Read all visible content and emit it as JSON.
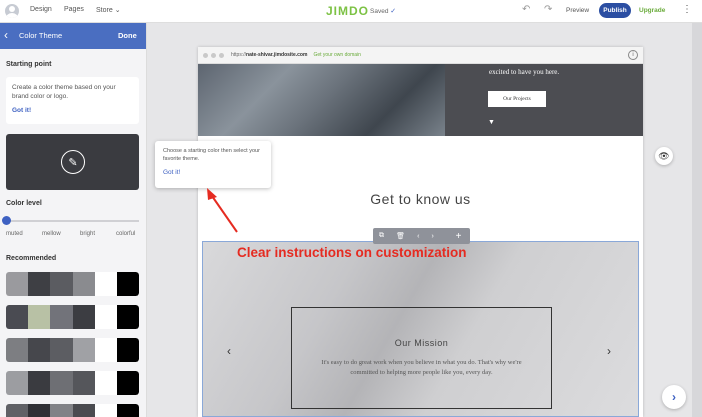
{
  "topbar": {
    "nav": [
      "Design",
      "Pages",
      "Store"
    ],
    "store_chevron": "⌄",
    "logo": "JIMDO",
    "saved": "Saved",
    "check_icon": "✓",
    "undo_icon": "↶",
    "redo_icon": "↷",
    "preview": "Preview",
    "publish": "Publish",
    "upgrade": "Upgrade",
    "more_icon": "⋮"
  },
  "panel": {
    "back_icon": "‹",
    "title": "Color Theme",
    "done": "Done",
    "starting_point_label": "Starting point",
    "info_text": "Create a color theme based on your brand color or logo.",
    "info_link": "Got it!",
    "pencil_icon": "✎",
    "color_level_label": "Color level",
    "levels": [
      "muted",
      "mellow",
      "bright",
      "colorful"
    ],
    "color_level_value": 0,
    "recommended_label": "Recommended",
    "swatches": [
      [
        "#9a9a9e",
        "#3e3f44",
        "#5b5c61",
        "#8a8b8f",
        "#ffffff",
        "#000000"
      ],
      [
        "#4a4b52",
        "#b8c1a5",
        "#72737a",
        "#3c3d42",
        "#ffffff",
        "#000000"
      ],
      [
        "#7d7e82",
        "#46474c",
        "#5c5d62",
        "#a0a1a5",
        "#ffffff",
        "#000000"
      ],
      [
        "#9c9da1",
        "#3a3b40",
        "#6e6f74",
        "#55565b",
        "#ffffff",
        "#000000"
      ],
      [
        "#606166",
        "#2f3035",
        "#818287",
        "#4a4b50",
        "#ffffff",
        "#000000"
      ]
    ]
  },
  "browser": {
    "url_prefix": "https://",
    "url_site": "nate-shivar.jimdosite.com",
    "url_domain": "Get your own domain",
    "info_icon": "i"
  },
  "site": {
    "hero_text": "excited to have you here.",
    "hero_button": "Our Projects",
    "hero_arrow": "▼",
    "section_title": "Get to know us",
    "mission_title": "Our Mission",
    "mission_text": "It's easy to do great work when you believe in what you do. That's why we're committed to helping more people like you, every day.",
    "prev_icon": "‹",
    "next_icon": "›"
  },
  "edit_toolbar": {
    "copy_icon": "⧉",
    "delete_icon": "🗑",
    "left_icon": "‹",
    "right_icon": "›",
    "add_icon": "+"
  },
  "tooltip": {
    "text": "Choose a starting color then select your favorite theme.",
    "link": "Got it!"
  },
  "annotation": "Clear instructions on customization",
  "colors": {
    "accent": "#3e61c2",
    "panel_header": "#4a6ec1",
    "publish": "#2b4ea2",
    "upgrade": "#6aab3b",
    "annotation": "#e52b21"
  },
  "eye_icon": "👁",
  "next_step_icon": "›"
}
